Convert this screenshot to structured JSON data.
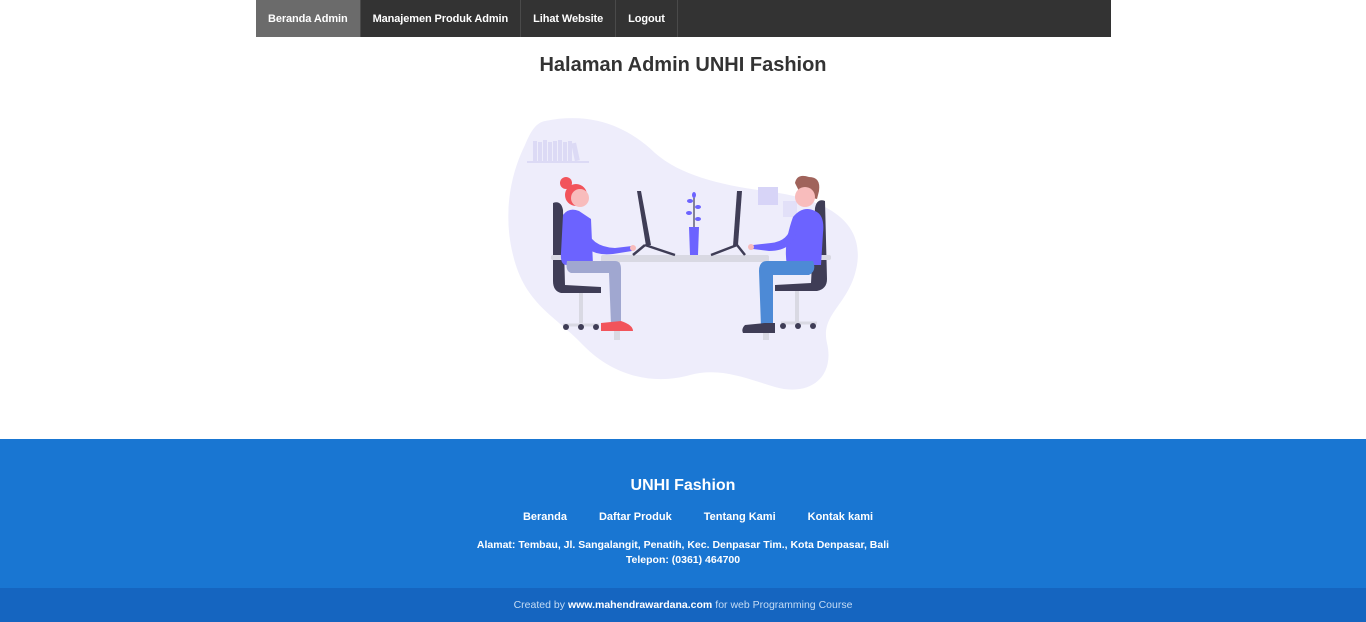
{
  "nav": {
    "items": [
      {
        "label": "Beranda Admin",
        "active": true
      },
      {
        "label": "Manajemen Produk Admin",
        "active": false
      },
      {
        "label": "Lihat Website",
        "active": false
      },
      {
        "label": "Logout",
        "active": false
      }
    ]
  },
  "main": {
    "title": "Halaman Admin UNHI Fashion",
    "illustration": "two-people-working-at-desk-illustration"
  },
  "footer": {
    "title": "UNHI Fashion",
    "links": [
      "Beranda",
      "Daftar Produk",
      "Tentang Kami",
      "Kontak kami"
    ],
    "address": "Alamat: Tembau, Jl. Sangalangit, Penatih, Kec. Denpasar Tim., Kota Denpasar, Bali",
    "phone": "Telepon: (0361) 464700",
    "copyright_prefix": "Created by",
    "copyright_site": "www.mahendrawardana.com",
    "copyright_suffix": "for web Programming Course"
  },
  "colors": {
    "navbar": "#333333",
    "nav_active": "#6b6b6b",
    "footer": "#1976d2",
    "copyright_bar": "#1565c0",
    "accent_purple": "#6c63ff"
  }
}
